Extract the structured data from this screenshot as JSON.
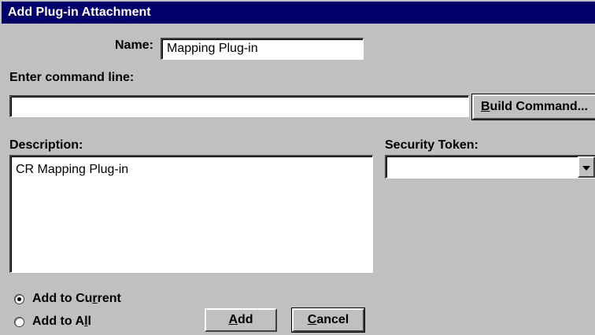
{
  "dialog": {
    "title": "Add Plug-in Attachment"
  },
  "name": {
    "label": "Name:",
    "value": "Mapping Plug-in"
  },
  "command": {
    "label": "Enter command line:",
    "value": "",
    "build_button": {
      "pre": "",
      "accel": "B",
      "post": "uild Command..."
    }
  },
  "description": {
    "label": "Description:",
    "value": "CR Mapping Plug-in"
  },
  "security": {
    "label": "Security Token:",
    "selected": ""
  },
  "scope": {
    "add_current": {
      "pre": "Add to Cu",
      "accel": "r",
      "post": "rent",
      "checked": true
    },
    "add_all": {
      "pre": "Add to A",
      "accel": "l",
      "post": "l",
      "checked": false
    }
  },
  "actions": {
    "add": {
      "pre": "",
      "accel": "A",
      "post": "dd"
    },
    "cancel": {
      "pre": "",
      "accel": "C",
      "post": "ancel"
    }
  }
}
